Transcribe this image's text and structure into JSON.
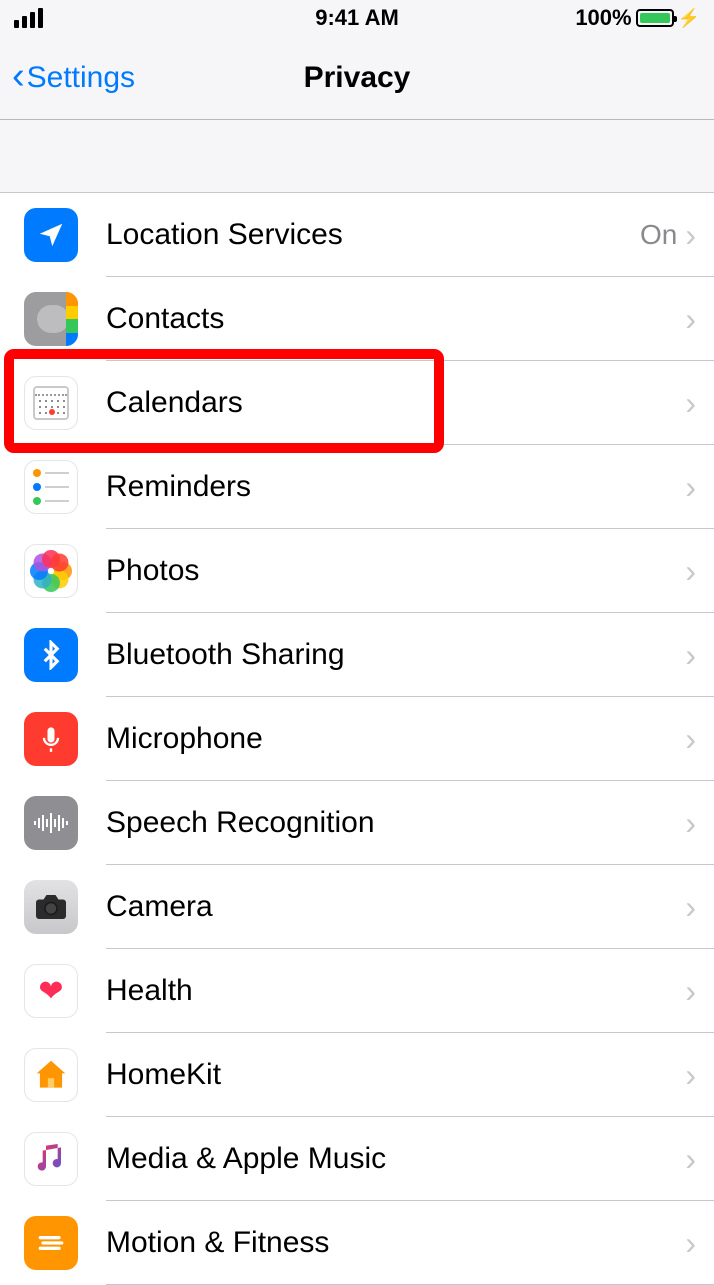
{
  "status": {
    "time": "9:41 AM",
    "battery_pct": "100%"
  },
  "nav": {
    "back_label": "Settings",
    "title": "Privacy"
  },
  "rows": [
    {
      "id": "location",
      "label": "Location Services",
      "value": "On",
      "icon": "location-arrow-icon"
    },
    {
      "id": "contacts",
      "label": "Contacts",
      "icon": "contacts-icon"
    },
    {
      "id": "calendars",
      "label": "Calendars",
      "icon": "calendar-icon",
      "highlighted": true
    },
    {
      "id": "reminders",
      "label": "Reminders",
      "icon": "reminders-icon"
    },
    {
      "id": "photos",
      "label": "Photos",
      "icon": "photos-icon"
    },
    {
      "id": "bluetooth",
      "label": "Bluetooth Sharing",
      "icon": "bluetooth-icon"
    },
    {
      "id": "microphone",
      "label": "Microphone",
      "icon": "microphone-icon"
    },
    {
      "id": "speech",
      "label": "Speech Recognition",
      "icon": "waveform-icon"
    },
    {
      "id": "camera",
      "label": "Camera",
      "icon": "camera-icon"
    },
    {
      "id": "health",
      "label": "Health",
      "icon": "heart-icon"
    },
    {
      "id": "homekit",
      "label": "HomeKit",
      "icon": "house-icon"
    },
    {
      "id": "media",
      "label": "Media & Apple Music",
      "icon": "music-note-icon"
    },
    {
      "id": "motion",
      "label": "Motion & Fitness",
      "icon": "motion-icon"
    }
  ]
}
